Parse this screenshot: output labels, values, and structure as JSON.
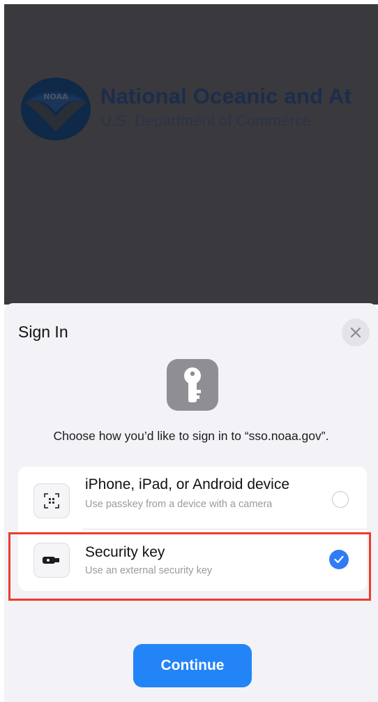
{
  "background_page": {
    "org_name": "National Oceanic and At",
    "department": "U.S. Department of Commerce",
    "logo_text": "NOAA"
  },
  "sheet": {
    "title": "Sign In",
    "close_icon": "close-icon",
    "key_icon": "key-icon",
    "prompt": "Choose how you’d like to sign in to “sso.noaa.gov”."
  },
  "options": [
    {
      "title": "iPhone, iPad, or Android device",
      "subtitle": "Use passkey from a device with a camera",
      "icon": "qr-scan-icon",
      "selected": false
    },
    {
      "title": "Security key",
      "subtitle": "Use an external security key",
      "icon": "usb-key-icon",
      "selected": true
    }
  ],
  "buttons": {
    "continue_label": "Continue"
  },
  "colors": {
    "accent": "#2384f8",
    "highlight": "#ee3b2b",
    "backdrop": "#3a393e"
  }
}
